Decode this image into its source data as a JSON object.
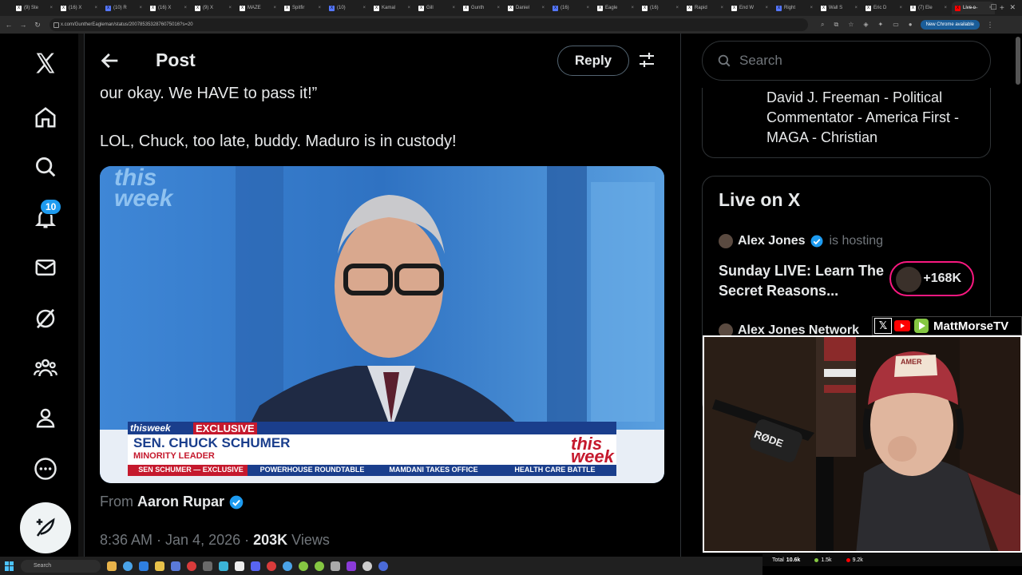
{
  "browser": {
    "tabs": [
      {
        "label": "(9) Ste"
      },
      {
        "label": "(16) X"
      },
      {
        "label": "(10) R"
      },
      {
        "label": "(16) X"
      },
      {
        "label": "(9) X"
      },
      {
        "label": "MAZE"
      },
      {
        "label": "Spitfir"
      },
      {
        "label": "(10)"
      },
      {
        "label": "Kamal"
      },
      {
        "label": "Gill"
      },
      {
        "label": "Gunth"
      },
      {
        "label": "Daniel"
      },
      {
        "label": "(16)"
      },
      {
        "label": "Eagle"
      },
      {
        "label": "(16)"
      },
      {
        "label": "Rapid"
      },
      {
        "label": "End W"
      },
      {
        "label": "Right"
      },
      {
        "label": "Wall S"
      },
      {
        "label": "Eric D"
      },
      {
        "label": "(7) Ele"
      },
      {
        "label": "Live o"
      }
    ],
    "url": "x.com/GuntherEagleman/status/2007853532876075016?s=20",
    "update_label": "New Chrome available"
  },
  "nav": {
    "notification_count": "10"
  },
  "post": {
    "header_title": "Post",
    "reply_label": "Reply",
    "text_line_1": "our okay. We HAVE to pass it!”",
    "text_line_2": "LOL, Chuck, too late, buddy.  Maduro is in custody!",
    "from_prefix": "From",
    "from_author": "Aaron Rupar",
    "timestamp": "8:36 AM · Jan 4, 2026 · ",
    "views_count": "203K",
    "views_label": " Views"
  },
  "video": {
    "show_logo_1": "this",
    "show_logo_2": "week",
    "lower_third_brand": "thisweek",
    "exclusive_label": "EXCLUSIVE",
    "name": "SEN. CHUCK SCHUMER",
    "role": "MINORITY LEADER",
    "ticker": [
      "SEN SCHUMER — EXCLUSIVE",
      "POWERHOUSE ROUNDTABLE",
      "MAMDANI TAKES OFFICE",
      "HEALTH CARE BATTLE"
    ],
    "corner_logo_1": "this",
    "corner_logo_2": "week"
  },
  "sidebar": {
    "search_placeholder": "Search",
    "bio_text": "David J. Freeman - Political Commentator - America First - MAGA - Christian",
    "live_title": "Live on X",
    "host_name": "Alex Jones",
    "host_status": "is hosting",
    "space_title": "Sunday LIVE: Learn The Secret Reasons...",
    "listeners": "+168K",
    "host2_name": "Alex Jones Network"
  },
  "overlay": {
    "brand_name": "MattMorseTV",
    "mic_label": "RØDE",
    "hat_text": "AMER",
    "stats": {
      "total_label": "Total",
      "total": "10.6k",
      "green": "1.5k",
      "red": "9.2k"
    }
  },
  "taskbar": {
    "search_label": "Search"
  },
  "colors": {
    "accent": "#1d9bf0",
    "live_ring": "#f91880",
    "background": "#000000",
    "text": "#e7e9ea",
    "muted": "#71767b"
  }
}
